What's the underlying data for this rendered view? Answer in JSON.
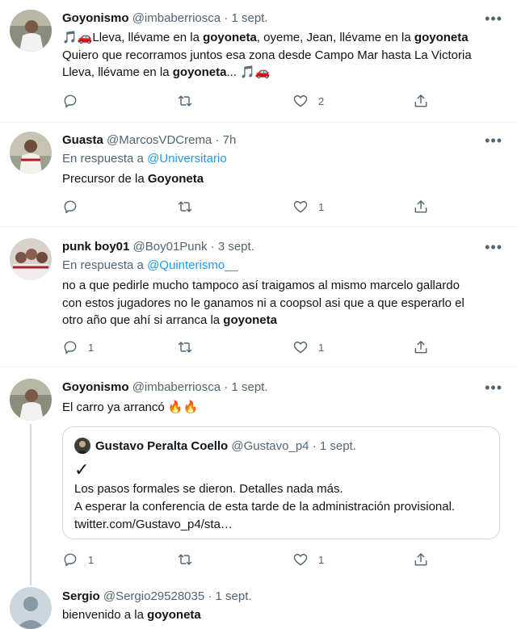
{
  "tweets": [
    {
      "name": "Goyonismo",
      "handle": "@imbaberriosca",
      "sep": "·",
      "date": "1 sept.",
      "lines": [
        {
          "pre": "🎵🚗Lleva, llévame en la ",
          "b1": "goyoneta",
          "mid": ", oyeme, Jean, llévame en la ",
          "b2": "goyoneta",
          "post": ""
        },
        {
          "pre": "Quiero que recorramos juntos esa zona desde Campo Mar hasta La Victoria",
          "b1": "",
          "mid": "",
          "b2": "",
          "post": ""
        },
        {
          "pre": "Lleva, llévame en la ",
          "b1": "goyoneta",
          "mid": "... 🎵🚗",
          "b2": "",
          "post": ""
        }
      ],
      "likes": "2"
    },
    {
      "name": "Guasta",
      "handle": "@MarcosVDCrema",
      "sep": "·",
      "date": "7h",
      "reply_prefix": "En respuesta a ",
      "reply_to": "@Universitario",
      "text_pre": "Precursor de la ",
      "text_bold": "Goyoneta",
      "likes": "1"
    },
    {
      "name": "punk boy01",
      "handle": "@Boy01Punk",
      "sep": "·",
      "date": "3 sept.",
      "reply_prefix": "En respuesta a ",
      "reply_to": "@Quinterismo__",
      "line1": "no a que pedirle mucho tampoco así traigamos al mismo marcelo gallardo",
      "line2": "con estos jugadores no le ganamos ni a coopsol asi que a que esperarlo el",
      "line3_pre": "otro año que ahí si arranca la ",
      "line3_bold": "goyoneta",
      "replies": "1",
      "likes": "1"
    },
    {
      "name": "Goyonismo",
      "handle": "@imbaberriosca",
      "sep": "·",
      "date": "1 sept.",
      "text": "El carro ya arrancó 🔥🔥",
      "quote": {
        "name": "Gustavo Peralta Coello",
        "handle": "@Gustavo_p4",
        "sep": "·",
        "date": "1 sept.",
        "check": "✓",
        "line1": "Los pasos formales se dieron. Detalles nada más.",
        "line2": "A esperar la conferencia de esta tarde de la administración provisional.",
        "line3": "twitter.com/Gustavo_p4/sta…"
      },
      "replies": "1",
      "likes": "1"
    },
    {
      "name": "Sergio",
      "handle": "@Sergio29528035",
      "sep": "·",
      "date": "1 sept.",
      "text_pre": "bienvenido a la ",
      "text_bold": "goyoneta"
    }
  ],
  "more_glyph": "•••",
  "icons": [
    "reply-icon",
    "retweet-icon",
    "like-icon",
    "share-icon",
    "more-icon"
  ],
  "colors": {
    "link": "#1d9bf0",
    "meta": "#536471",
    "text": "#0f1419",
    "border": "#eff3f4"
  }
}
